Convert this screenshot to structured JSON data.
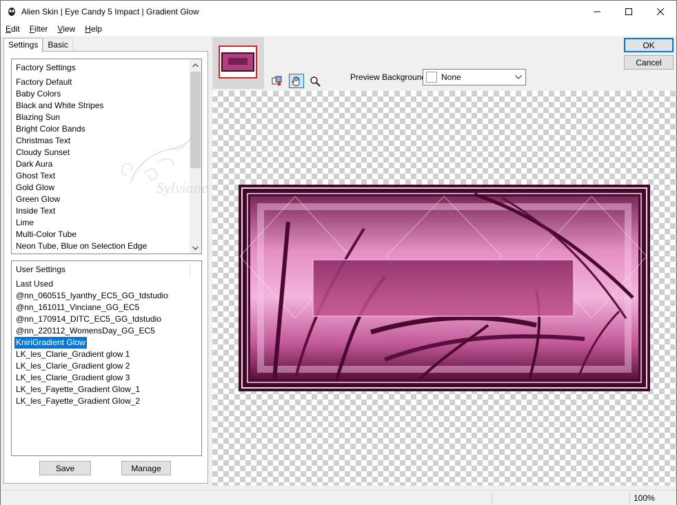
{
  "window": {
    "title": "Alien Skin | Eye Candy 5 Impact | Gradient Glow"
  },
  "menu": {
    "edit": {
      "key": "E",
      "rest": "dit"
    },
    "filter": {
      "key": "F",
      "rest": "ilter"
    },
    "view": {
      "key": "V",
      "rest": "iew"
    },
    "help": {
      "key": "H",
      "rest": "elp"
    }
  },
  "tabs": {
    "settings": "Settings",
    "basic": "Basic"
  },
  "factory": {
    "header": "Factory Settings",
    "items": [
      "Factory Default",
      "Baby Colors",
      "Black and White Stripes",
      "Blazing Sun",
      "Bright Color Bands",
      "Christmas Text",
      "Cloudy Sunset",
      "Dark Aura",
      "Ghost Text",
      "Gold Glow",
      "Green Glow",
      "Inside Text",
      "Lime",
      "Multi-Color Tube",
      "Neon Tube, Blue on Selection Edge"
    ]
  },
  "user": {
    "header": "User Settings",
    "items": [
      "Last Used",
      "@nn_060515_lyanthy_EC5_GG_tdstudio",
      "@nn_161011_Vinciane_GG_EC5",
      "@nn_170914_DITC_EC5_GG_tdstudio",
      "@nn_220112_WomensDay_GG_EC5",
      "KniriGradient Glow",
      "LK_les_Clarie_Gradient glow 1",
      "LK_les_Clarie_Gradient glow 2",
      "LK_les_Clarie_Gradient glow 3",
      "LK_les_Fayette_Gradient Glow_1",
      "LK_les_Fayette_Gradient Glow_2"
    ],
    "selected_index": 5
  },
  "buttons": {
    "save": "Save",
    "manage": "Manage",
    "ok": "OK",
    "cancel": "Cancel"
  },
  "preview_background": {
    "label": "Preview Background:",
    "value": "None"
  },
  "status": {
    "zoom": "100%"
  },
  "watermark_text": "Sylviane",
  "colors": {
    "accent": "#0078d7",
    "frame_dark": "#4a0a30",
    "frame_pink": "#c4558f"
  }
}
